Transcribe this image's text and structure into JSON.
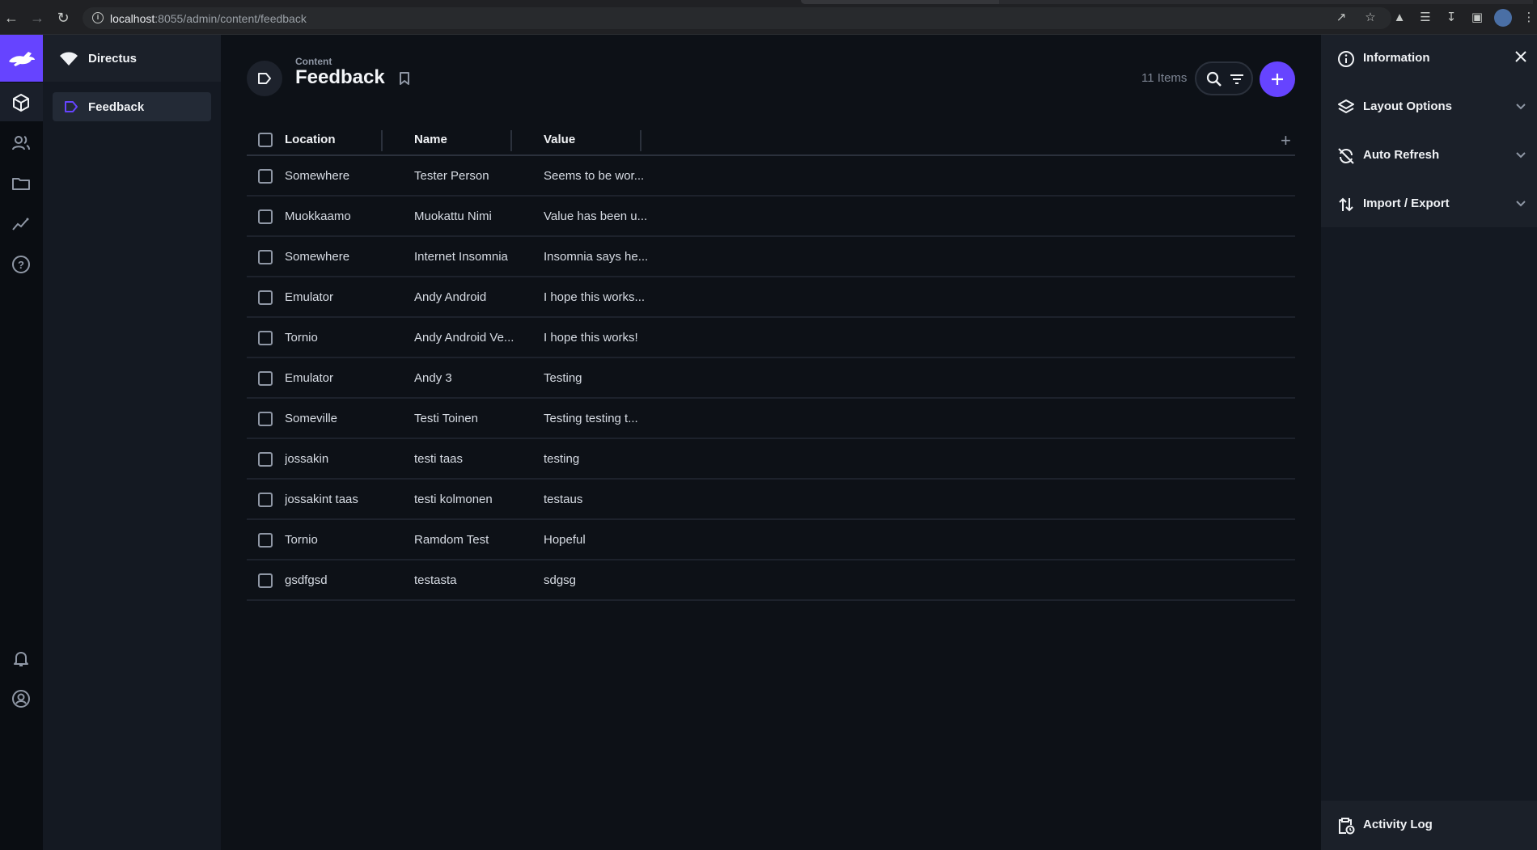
{
  "browser": {
    "url_host": "localhost",
    "url_rest": ":8055/admin/content/feedback"
  },
  "app": {
    "project_name": "Directus",
    "modules": [
      "content",
      "users",
      "files",
      "insights",
      "help",
      "notifications",
      "user-profile"
    ]
  },
  "nav": {
    "items": [
      {
        "label": "Feedback"
      }
    ]
  },
  "header": {
    "breadcrumb": "Content",
    "title": "Feedback",
    "item_count": "11 Items"
  },
  "table": {
    "columns": [
      "Location",
      "Name",
      "Value"
    ],
    "rows": [
      [
        "Somewhere",
        "Tester Person",
        "Seems to be wor..."
      ],
      [
        "Muokkaamo",
        "Muokattu Nimi",
        "Value has been u..."
      ],
      [
        "Somewhere",
        "Internet Insomnia",
        "Insomnia says he..."
      ],
      [
        "Emulator",
        "Andy Android",
        "I hope this works..."
      ],
      [
        "Tornio",
        "Andy Android Ve...",
        "I hope this works!"
      ],
      [
        "Emulator",
        "Andy 3",
        "Testing"
      ],
      [
        "Someville",
        "Testi Toinen",
        "Testing testing t..."
      ],
      [
        "jossakin",
        "testi taas",
        "testing"
      ],
      [
        "jossakint taas",
        "testi kolmonen",
        "testaus"
      ],
      [
        "Tornio",
        "Ramdom Test",
        "Hopeful"
      ],
      [
        "gsdfgsd",
        "testasta",
        "sdgsg"
      ]
    ]
  },
  "sidebar": {
    "information": "Information",
    "layout_options": "Layout Options",
    "auto_refresh": "Auto Refresh",
    "import_export": "Import / Export",
    "activity_log": "Activity Log"
  },
  "colors": {
    "accent": "#6644ff",
    "background": "#0d1117"
  }
}
